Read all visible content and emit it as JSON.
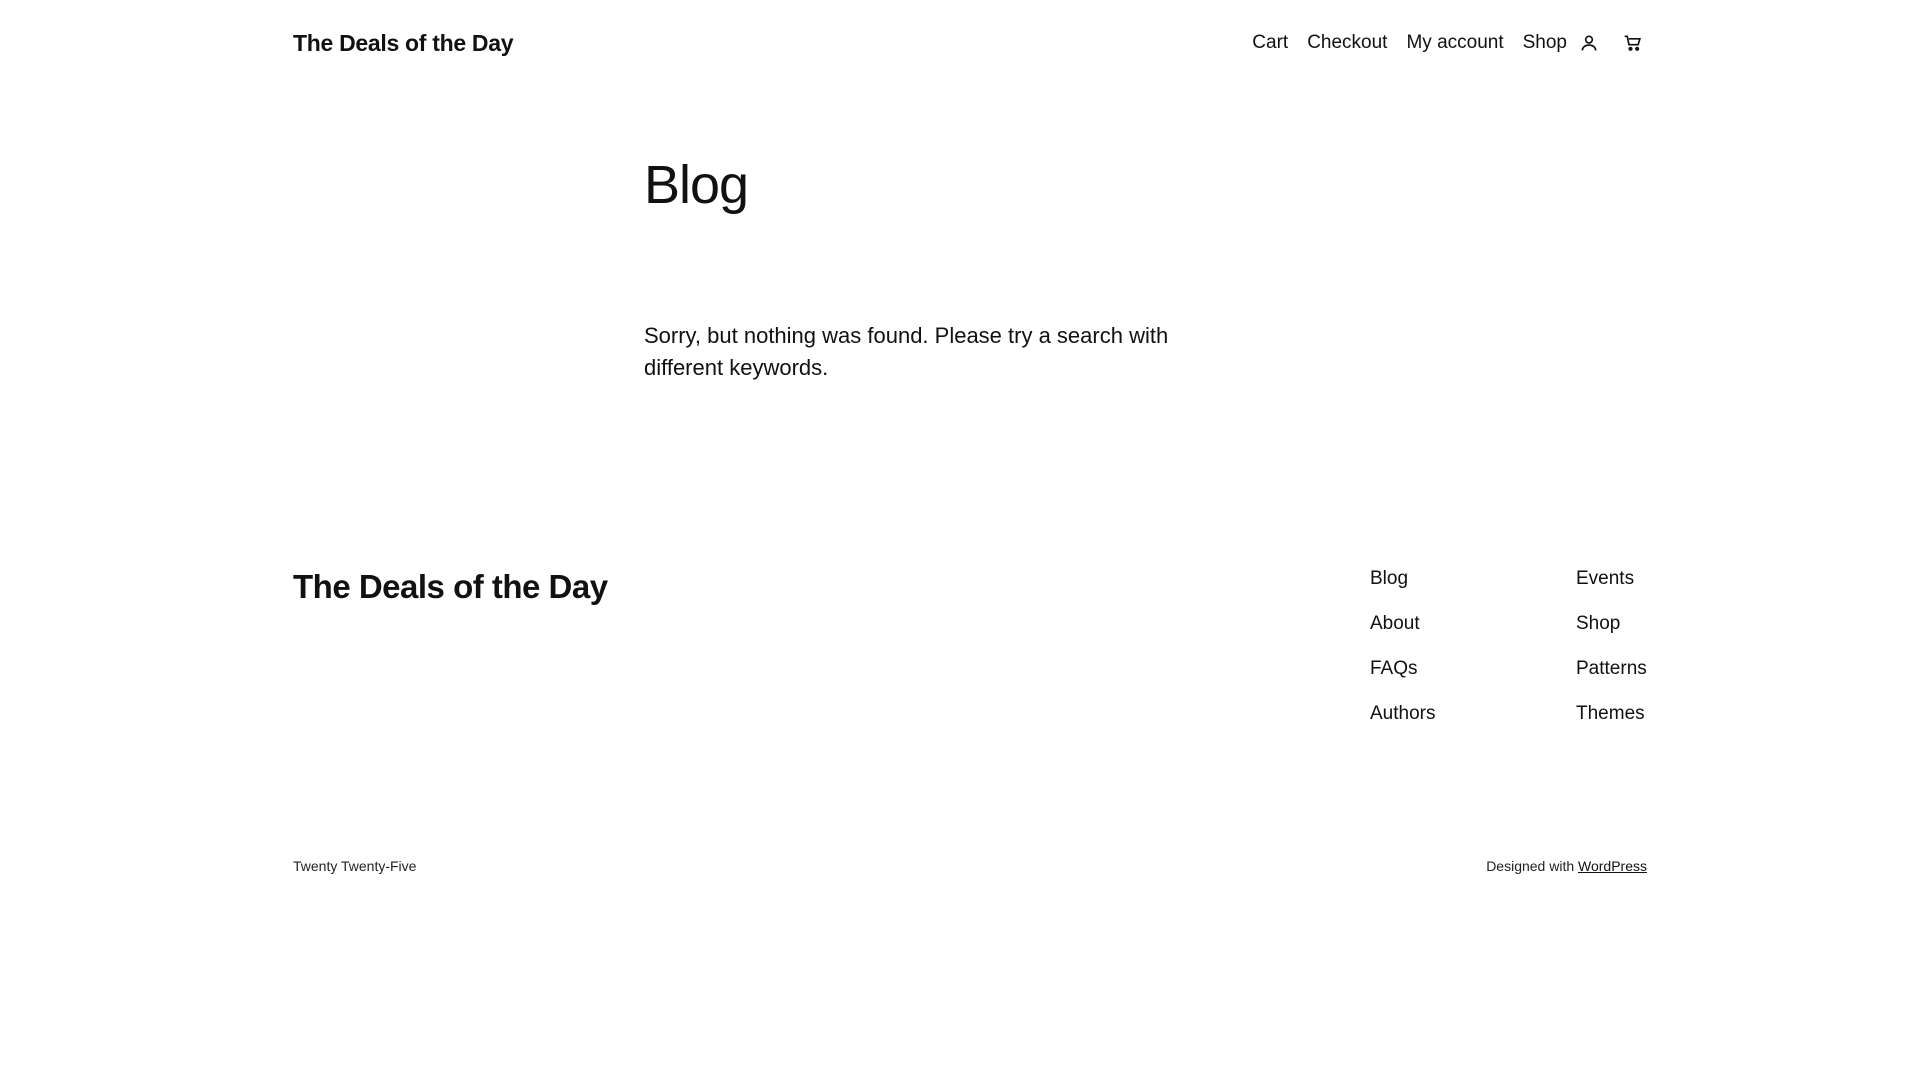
{
  "header": {
    "site_title": "The Deals of the Day",
    "nav": {
      "cart": "Cart",
      "checkout": "Checkout",
      "my_account": "My account",
      "shop": "Shop"
    },
    "icons": {
      "account": "user-icon",
      "cart": "cart-icon"
    }
  },
  "main": {
    "title": "Blog",
    "message": "Sorry, but nothing was found. Please try a search with different keywords."
  },
  "footer": {
    "site_title": "The Deals of the Day",
    "col1": [
      "Blog",
      "About",
      "FAQs",
      "Authors"
    ],
    "col2": [
      "Events",
      "Shop",
      "Patterns",
      "Themes"
    ],
    "theme_name": "Twenty Twenty-Five",
    "designed_with": "Designed with",
    "wordpress": "WordPress"
  }
}
